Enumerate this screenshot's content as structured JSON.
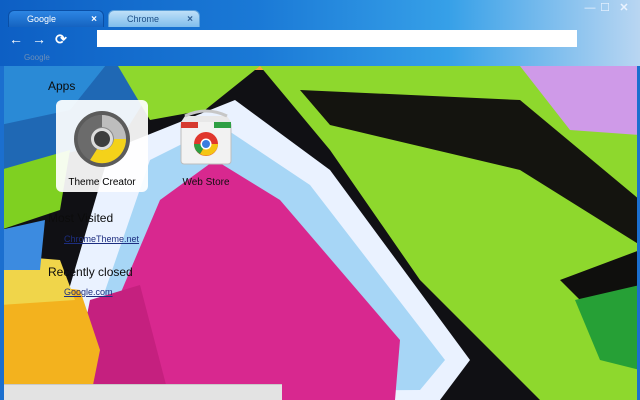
{
  "tabs": [
    {
      "label": "Google",
      "close": "×"
    },
    {
      "label": "Chrome",
      "close": "×"
    }
  ],
  "window_controls": {
    "minimize": "—",
    "maximize": "☐",
    "close": "✕"
  },
  "toolbar": {
    "back_icon": "arrow-left-icon",
    "forward_icon": "arrow-right-icon",
    "reload_icon": "reload-icon",
    "back_glyph": "←",
    "forward_glyph": "→",
    "reload_glyph": "⟳",
    "omnibox_value": ""
  },
  "bookmark_bar": {
    "ghost_label": "Google"
  },
  "ntp": {
    "apps_title": "Apps",
    "apps": [
      {
        "label": "Theme Creator",
        "icon": "theme-creator-icon"
      },
      {
        "label": "Web Store",
        "icon": "web-store-icon"
      }
    ],
    "most_visited_title": "Most Visited",
    "most_visited": [
      {
        "label": "ChromeTheme.net"
      }
    ],
    "recently_closed_title": "Recently closed",
    "recently_closed": [
      {
        "label": "Google.com"
      }
    ]
  },
  "colors": {
    "frame": "#1b6fcf",
    "accent_green": "#8fdb2a",
    "magenta": "#d8288f",
    "violet": "#c99be7"
  }
}
